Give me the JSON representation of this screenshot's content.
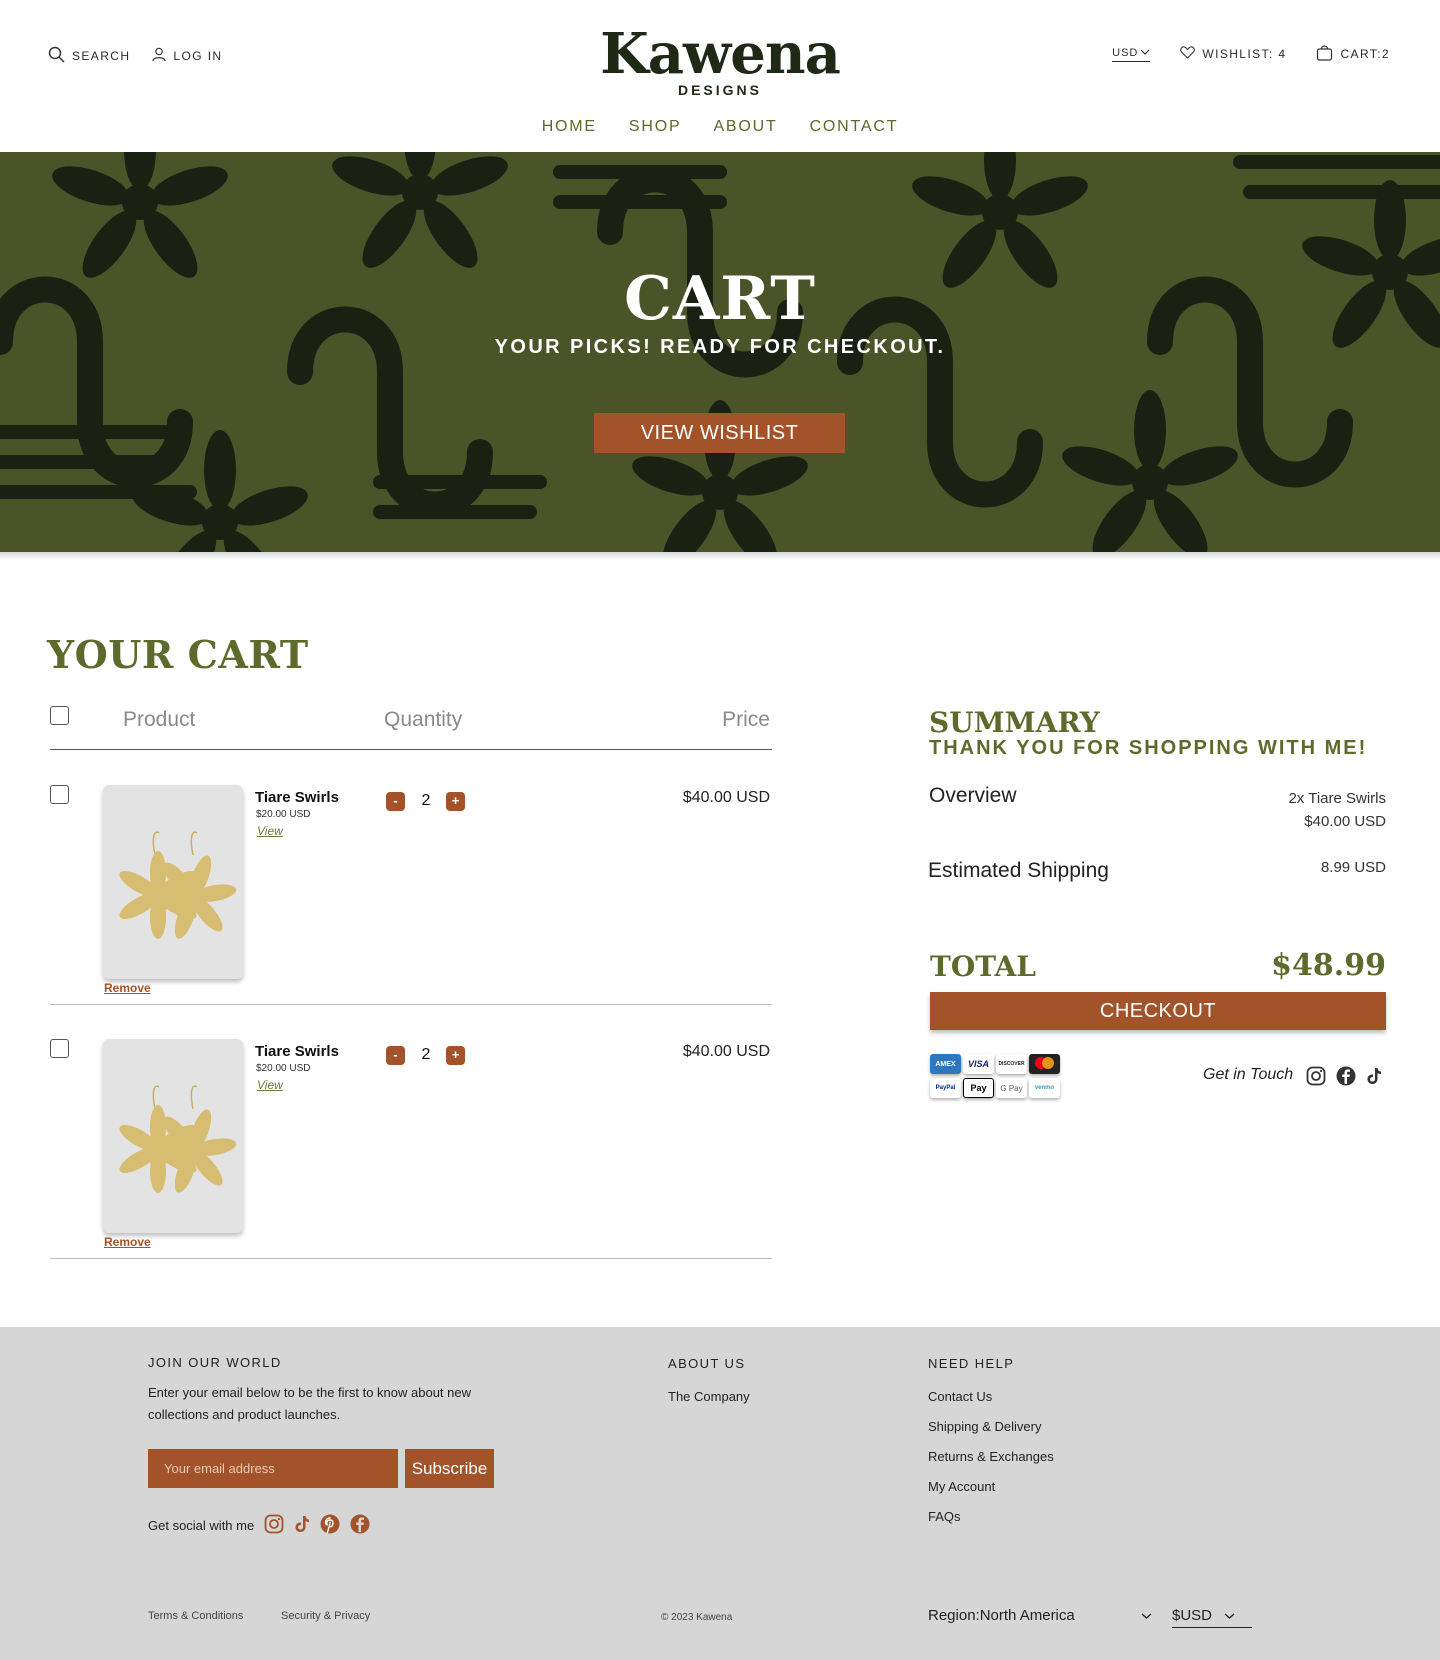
{
  "header": {
    "search_label": "SEARCH",
    "login_label": "LOG IN",
    "logo_main": "Kawena",
    "logo_sub": "DESIGNS",
    "currency": "USD",
    "wishlist_label": "WISHLIST: 4",
    "cart_label": "CART:2",
    "nav": [
      "HOME",
      "SHOP",
      "ABOUT",
      "CONTACT"
    ]
  },
  "hero": {
    "title": "CART",
    "subtitle": "YOUR PICKS! READY FOR CHECKOUT.",
    "button": "VIEW WISHLIST"
  },
  "cart": {
    "title": "YOUR CART",
    "columns": {
      "product": "Product",
      "quantity": "Quantity",
      "price": "Price"
    },
    "items": [
      {
        "name": "Tiare Swirls",
        "unit_price": "$20.00 USD",
        "view": "View",
        "quantity": "2",
        "minus": "-",
        "plus": "+",
        "price": "$40.00 USD",
        "remove": "Remove"
      },
      {
        "name": "Tiare Swirls",
        "unit_price": "$20.00 USD",
        "view": "View",
        "quantity": "2",
        "minus": "-",
        "plus": "+",
        "price": "$40.00 USD",
        "remove": "Remove"
      }
    ]
  },
  "summary": {
    "title": "SUMMARY",
    "subtitle": "THANK YOU FOR SHOPPING WITH ME!",
    "overview_label": "Overview",
    "overview_items": "2x Tiare Swirls",
    "overview_price": "$40.00 USD",
    "shipping_label": "Estimated Shipping",
    "shipping_value": "8.99 USD",
    "total_label": "TOTAL",
    "total_value": "$48.99",
    "checkout_button": "CHECKOUT",
    "payment_methods": [
      "AMEX",
      "VISA",
      "DISCOVER",
      "mastercard",
      "PayPal",
      "Pay",
      "G Pay",
      "venmo"
    ],
    "get_in_touch": "Get in Touch"
  },
  "footer": {
    "join_title": "JOIN OUR WORLD",
    "join_text": "Enter your email below to be the first to know about new collections and product launches.",
    "email_placeholder": "Your email address",
    "subscribe": "Subscribe",
    "social_label": "Get social with me",
    "about_title": "ABOUT US",
    "about_links": [
      "The Company"
    ],
    "help_title": "NEED HELP",
    "help_links": [
      "Contact Us",
      "Shipping & Delivery",
      "Returns & Exchanges",
      "My Account",
      "FAQs"
    ],
    "terms": "Terms & Conditions",
    "security": "Security & Privacy",
    "copyright": "© 2023 Kawena",
    "region_label": "Region:North America",
    "currency_label": "$USD"
  },
  "colors": {
    "brand_green": "#5c6a2c",
    "dark_green": "#1f2a16",
    "accent_rust": "#a3532a",
    "footer_gray": "#d6d6d6"
  }
}
